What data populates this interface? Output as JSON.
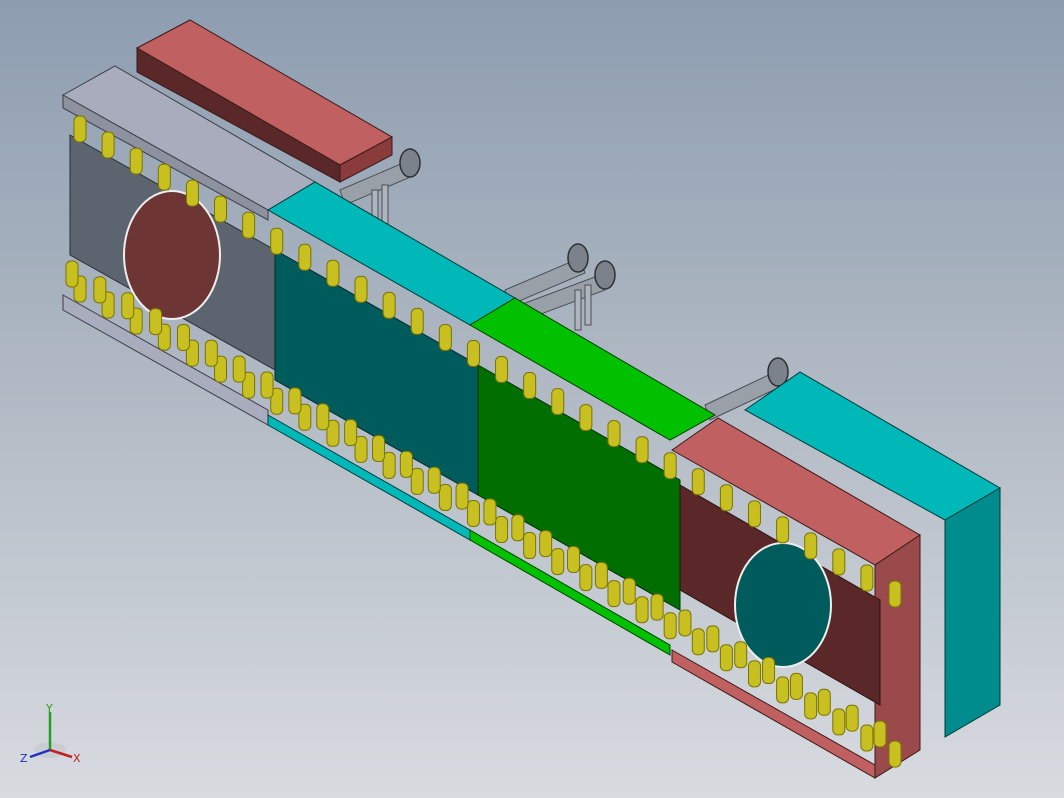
{
  "viewport": {
    "background_top": "#8d9db0",
    "background_bottom": "#d8dbe0"
  },
  "colors": {
    "grey_block": "#5c6470",
    "grey_top": "#a9acbd",
    "red_block": "#6e3535",
    "red_top": "#c06060",
    "cyan_block": "#005c5c",
    "cyan_top": "#00b8b8",
    "green_block": "#006e00",
    "green_top": "#00c000",
    "roller": "#c8c020",
    "roller_dark": "#7a7400",
    "frame": "#8a8f98"
  },
  "triad": {
    "x_label": "X",
    "y_label": "Y",
    "z_label": "Z",
    "x_color": "#c02020",
    "y_color": "#20a020",
    "z_color": "#2030c0"
  }
}
